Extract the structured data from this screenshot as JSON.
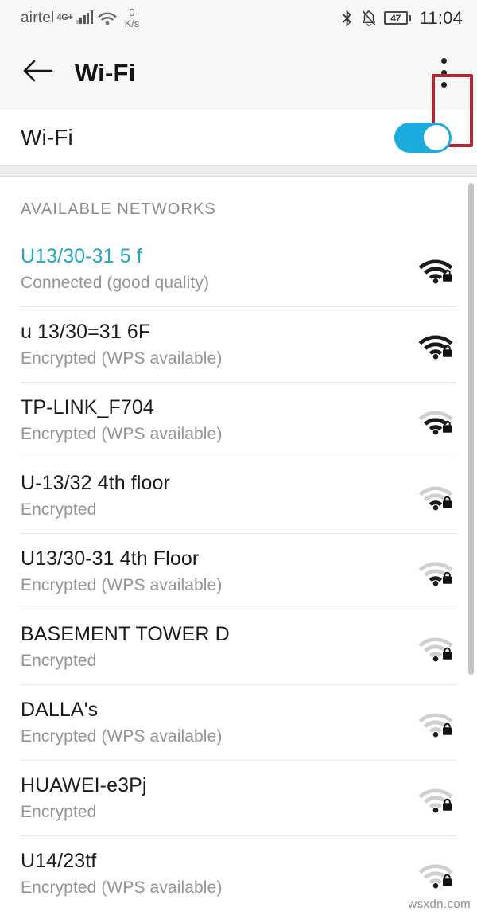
{
  "status_bar": {
    "carrier": "airtel",
    "network_type": "4G+",
    "signal_icon": "signal-bars-icon",
    "wifi_icon": "wifi-icon",
    "data_rate_value": "0",
    "data_rate_unit": "K/s",
    "bluetooth_icon": "bluetooth-icon",
    "silent_icon": "bell-muted-icon",
    "battery_level": "47",
    "time": "11:04"
  },
  "app_bar": {
    "back_icon": "back-arrow-icon",
    "title": "Wi-Fi",
    "overflow_icon": "overflow-menu-icon",
    "highlight_color": "#b3262f"
  },
  "wifi_toggle": {
    "label": "Wi-Fi",
    "state": "on",
    "accent_color": "#1cabde"
  },
  "networks": {
    "section_header": "AVAILABLE NETWORKS",
    "connected_color": "#22a8bd",
    "items": [
      {
        "ssid": "U13/30-31 5 f",
        "status": "Connected (good quality)",
        "connected": true,
        "signal": 4,
        "secured": true,
        "icon": "wifi-lock-icon"
      },
      {
        "ssid": "u 13/30=31 6F",
        "status": "Encrypted (WPS available)",
        "connected": false,
        "signal": 4,
        "secured": true,
        "icon": "wifi-lock-icon"
      },
      {
        "ssid": "TP-LINK_F704",
        "status": "Encrypted (WPS available)",
        "connected": false,
        "signal": 3,
        "secured": true,
        "icon": "wifi-lock-icon"
      },
      {
        "ssid": "U-13/32 4th floor",
        "status": "Encrypted",
        "connected": false,
        "signal": 2,
        "secured": true,
        "icon": "wifi-lock-icon"
      },
      {
        "ssid": "U13/30-31 4th Floor",
        "status": "Encrypted (WPS available)",
        "connected": false,
        "signal": 2,
        "secured": true,
        "icon": "wifi-lock-icon"
      },
      {
        "ssid": "BASEMENT TOWER D",
        "status": "Encrypted",
        "connected": false,
        "signal": 1,
        "secured": true,
        "icon": "wifi-lock-icon"
      },
      {
        "ssid": "DALLA's",
        "status": "Encrypted (WPS available)",
        "connected": false,
        "signal": 1,
        "secured": true,
        "icon": "wifi-lock-icon"
      },
      {
        "ssid": "HUAWEI-e3Pj",
        "status": "Encrypted",
        "connected": false,
        "signal": 1,
        "secured": true,
        "icon": "wifi-lock-icon"
      },
      {
        "ssid": "U14/23tf",
        "status": "Encrypted (WPS available)",
        "connected": false,
        "signal": 1,
        "secured": true,
        "icon": "wifi-lock-icon"
      }
    ]
  },
  "watermark": "wsxdn.com"
}
